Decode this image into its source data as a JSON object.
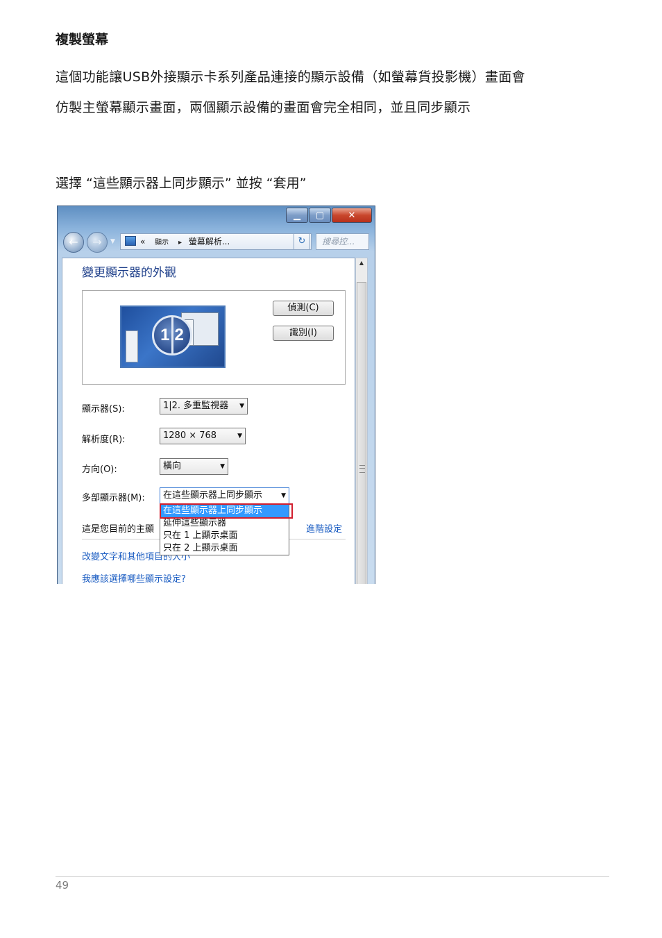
{
  "document": {
    "heading": "複製螢幕",
    "paragraph_line1": "這個功能讓USB外接顯示卡系列產品連接的顯示設備（如螢幕貨投影機）畫面會",
    "paragraph_line2": "仿製主螢幕顯示畫面，兩個顯示設備的畫面會完全相同，並且同步顯示",
    "instruction": "選擇 “這些顯示器上同步顯示” 並按 “套用”",
    "page_number": "49"
  },
  "window": {
    "nav": {
      "breadcrumb_prefix": "«",
      "crumb1": "顯示",
      "crumb_sep": "▸",
      "crumb2": "螢幕解析...",
      "search_placeholder": "搜尋控..."
    },
    "title": "變更顯示器的外觀",
    "preview": {
      "badge_left": "1",
      "badge_right": "2",
      "detect_button": "偵測(C)",
      "identify_button": "識別(I)"
    },
    "fields": {
      "display_label": "顯示器(S):",
      "display_value": "1|2. 多重監視器",
      "resolution_label": "解析度(R):",
      "resolution_value": "1280 × 768",
      "orientation_label": "方向(O):",
      "orientation_value": "橫向",
      "multi_label": "多部顯示器(M):",
      "multi_value": "在這些顯示器上同步顯示"
    },
    "dropdown_options": [
      "在這些顯示器上同步顯示",
      "延伸這些顯示器",
      "只在 1 上顯示桌面",
      "只在 2 上顯示桌面"
    ],
    "note": "這是您目前的主顯",
    "advanced_link": "進階設定",
    "link_text_size": "改變文字和其他項目的大小",
    "link_which_settings": "我應該選擇哪些顯示設定?"
  },
  "colors": {
    "link": "#1a5cc2",
    "title_blue": "#1e3f8a",
    "highlight_red": "#d21e2e",
    "selection_blue": "#3399ff"
  }
}
